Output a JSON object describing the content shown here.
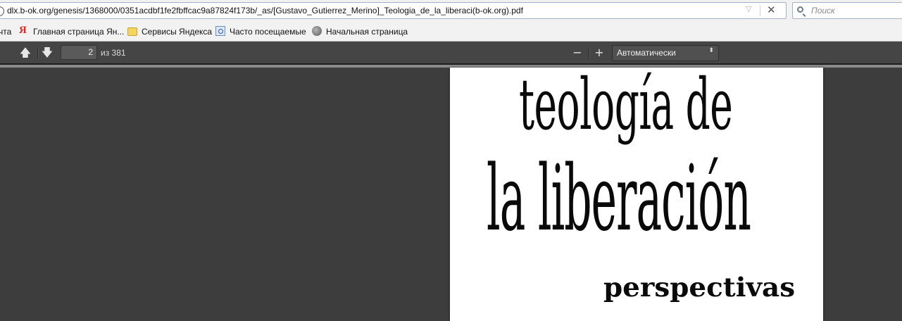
{
  "urlbar": {
    "info_icon": "i",
    "url": "dlx.b-ok.org/genesis/1368000/0351acdbf1fe2fbffcac9a87824f173b/_as/[Gustavo_Gutierrez_Merino]_Teologia_de_la_liberaci(b-ok.org).pdf",
    "dropdown_icon": "▽",
    "clear_icon": "✕"
  },
  "search": {
    "placeholder": "Поиск"
  },
  "bookmarks": {
    "items": [
      {
        "label": "чта",
        "icon": "none"
      },
      {
        "label": "Главная страница Ян...",
        "icon": "yandex-icon",
        "glyph": "Я"
      },
      {
        "label": "Сервисы Яндекса",
        "icon": "folder-icon"
      },
      {
        "label": "Часто посещаемые",
        "icon": "frequent-sites-icon"
      },
      {
        "label": "Начальная страница",
        "icon": "globe-icon"
      }
    ]
  },
  "pdf_toolbar": {
    "prev_icon": "🡅",
    "next_icon": "🡇",
    "current_page": "2",
    "page_count": "из 381",
    "zoom_out": "−",
    "zoom_in": "+",
    "zoom_value": "Автоматически",
    "zoom_arrows": "⬍"
  },
  "document": {
    "title_line1": "teología de",
    "title_line2": "la liberación",
    "subtitle": "perspectivas"
  },
  "colors": {
    "viewer_bg": "#3d3d3d",
    "toolbar_bg": "#454545",
    "chrome_bg": "#f2f2f2",
    "yandex_red": "#e52620"
  }
}
